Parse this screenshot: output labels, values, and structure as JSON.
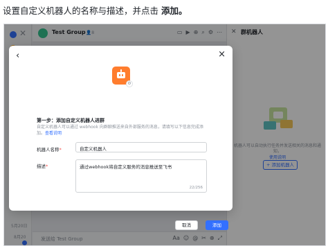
{
  "instruction": {
    "prefix": "设置自定义机器人的名称与描述，并点击 ",
    "emphasis": "添加。"
  },
  "chat": {
    "group_name": "Test Group",
    "member_count": "8",
    "input_placeholder": "发送给 Test Group"
  },
  "rail": {
    "date1": "5月20日",
    "date2": "8月20"
  },
  "right_panel": {
    "title": "群机器人",
    "empty_text": "机器人可以自动执行任务并发送相关的消息和通知，",
    "empty_link": "使用说明",
    "add_button": "+ 添加机器人"
  },
  "modal": {
    "step_title": "第一步：添加自定义机器人进群",
    "description": "自定义机器人可以通过 webhook 向群聊推送来自外部服务的消息，请填写以下信息完成添加。",
    "description_link": "查看说明",
    "name_label": "机器人名称",
    "name_value": "自定义机器人",
    "desc_label": "描述",
    "desc_value": "通过webhook将自定义服务的消息推送至飞书",
    "desc_count": "22/256",
    "cancel_label": "取消",
    "add_label": "添加"
  },
  "colors": {
    "primary": "#3370ff",
    "bot_orange": "#ff7d2e"
  }
}
